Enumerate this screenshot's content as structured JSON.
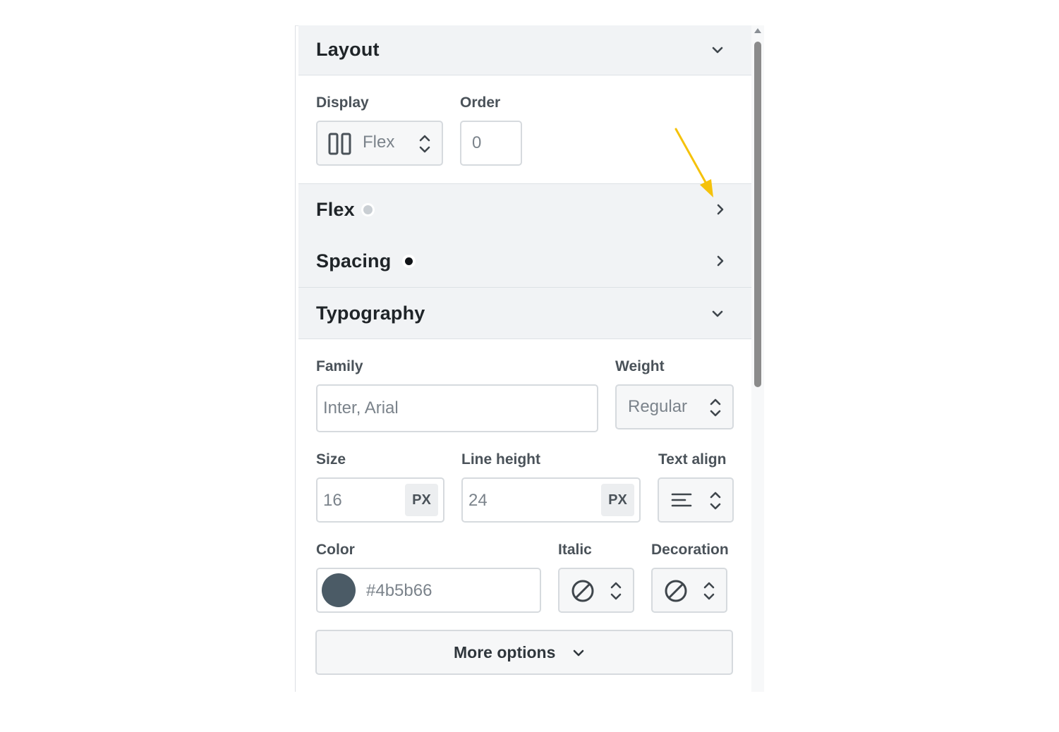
{
  "sections": {
    "layout": {
      "title": "Layout",
      "expanded": true
    },
    "flex": {
      "title": "Flex",
      "expanded": false
    },
    "spacing": {
      "title": "Spacing",
      "expanded": false
    },
    "typography": {
      "title": "Typography",
      "expanded": true
    }
  },
  "layout": {
    "display_label": "Display",
    "display_value": "Flex",
    "order_label": "Order",
    "order_placeholder": "0"
  },
  "typography": {
    "family_label": "Family",
    "family_placeholder": "Inter, Arial",
    "weight_label": "Weight",
    "weight_value": "Regular",
    "size_label": "Size",
    "size_placeholder": "16",
    "size_unit": "PX",
    "line_height_label": "Line height",
    "line_height_placeholder": "24",
    "line_height_unit": "PX",
    "text_align_label": "Text align",
    "color_label": "Color",
    "color_value": "#4b5b66",
    "color_placeholder": "#4b5b66",
    "italic_label": "Italic",
    "decoration_label": "Decoration",
    "more_options_label": "More options"
  },
  "colors": {
    "annotation_arrow": "#f5c20b",
    "section_header_bg": "#f1f3f5",
    "swatch": "#4b5b66"
  },
  "icons": [
    "chevron-down-icon",
    "chevron-right-icon",
    "display-flex-icon",
    "stepper-icon",
    "align-left-icon",
    "none-icon"
  ]
}
